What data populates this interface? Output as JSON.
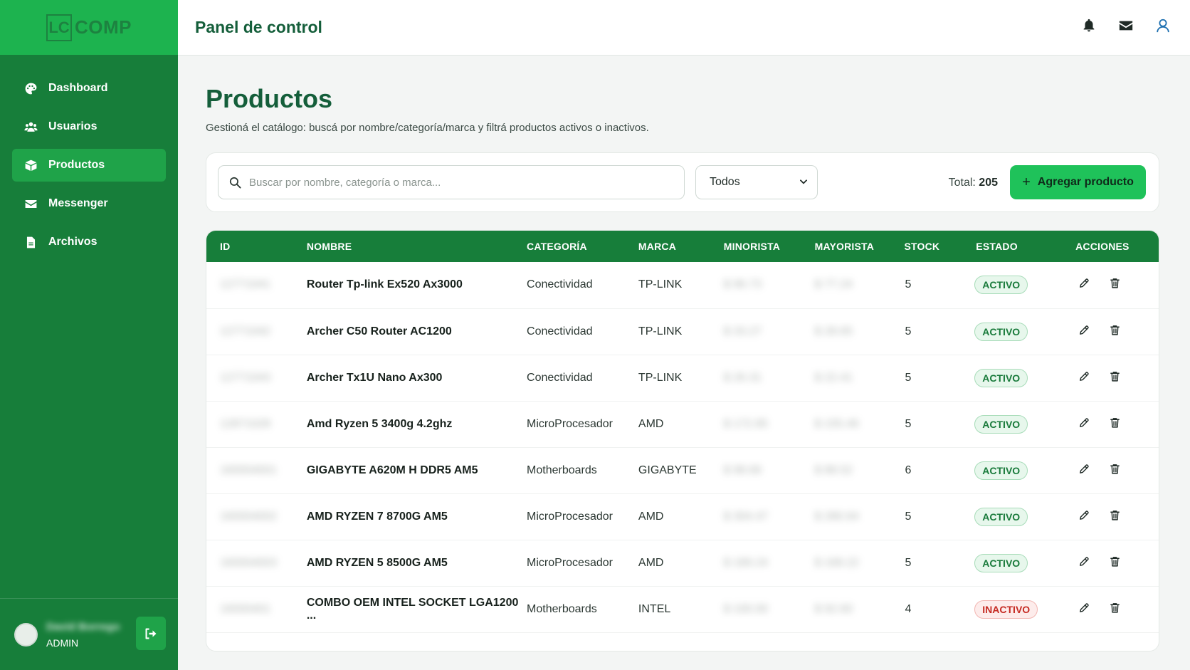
{
  "brand": {
    "logo_mark": "LC",
    "logo_text": "COMP"
  },
  "sidebar": {
    "items": [
      {
        "label": "Dashboard",
        "icon": "palette-icon"
      },
      {
        "label": "Usuarios",
        "icon": "users-icon"
      },
      {
        "label": "Productos",
        "icon": "box-icon",
        "active": true
      },
      {
        "label": "Messenger",
        "icon": "envelope-icon"
      },
      {
        "label": "Archivos",
        "icon": "file-icon"
      }
    ],
    "user": {
      "name": "David Borrego",
      "role": "ADMIN"
    }
  },
  "header": {
    "title": "Panel de control"
  },
  "page": {
    "title": "Productos",
    "subtitle": "Gestioná el catálogo: buscá por nombre/categoría/marca y filtrá productos activos o inactivos."
  },
  "toolbar": {
    "search_placeholder": "Buscar por nombre, categoría o marca...",
    "filter_value": "Todos",
    "total_label": "Total:",
    "total_value": "205",
    "add_label": "Agregar producto"
  },
  "table": {
    "columns": [
      "ID",
      "NOMBRE",
      "CATEGORÍA",
      "MARCA",
      "MINORISTA",
      "MAYORISTA",
      "STOCK",
      "ESTADO",
      "ACCIONES"
    ],
    "rows": [
      {
        "id": "12771041",
        "name": "Router Tp-link Ex520 Ax3000",
        "category": "Conectividad",
        "brand": "TP-LINK",
        "retail": "$ 96.73",
        "wholesale": "$ 77.24",
        "stock": "5",
        "status": "ACTIVO",
        "active": true
      },
      {
        "id": "12771042",
        "name": "Archer C50 Router AC1200",
        "category": "Conectividad",
        "brand": "TP-LINK",
        "retail": "$ 33.27",
        "wholesale": "$ 28.65",
        "stock": "5",
        "status": "ACTIVO",
        "active": true
      },
      {
        "id": "12771043",
        "name": "Archer Tx1U Nano Ax300",
        "category": "Conectividad",
        "brand": "TP-LINK",
        "retail": "$ 26.31",
        "wholesale": "$ 22.41",
        "stock": "5",
        "status": "ACTIVO",
        "active": true
      },
      {
        "id": "12871028",
        "name": "Amd Ryzen 5 3400g 4.2ghz",
        "category": "MicroProcesador",
        "brand": "AMD",
        "retail": "$ 172.85",
        "wholesale": "$ 155.46",
        "stock": "5",
        "status": "ACTIVO",
        "active": true
      },
      {
        "id": "160004001",
        "name": "GIGABYTE A620M H DDR5 AM5",
        "category": "Motherboards",
        "brand": "GIGABYTE",
        "retail": "$ 98.66",
        "wholesale": "$ 88.52",
        "stock": "6",
        "status": "ACTIVO",
        "active": true
      },
      {
        "id": "160004002",
        "name": "AMD RYZEN 7 8700G AM5",
        "category": "MicroProcesador",
        "brand": "AMD",
        "retail": "$ 304.47",
        "wholesale": "$ 280.64",
        "stock": "5",
        "status": "ACTIVO",
        "active": true
      },
      {
        "id": "160004003",
        "name": "AMD RYZEN 5 8500G AM5",
        "category": "MicroProcesador",
        "brand": "AMD",
        "retail": "$ 189.24",
        "wholesale": "$ 168.22",
        "stock": "5",
        "status": "ACTIVO",
        "active": true
      },
      {
        "id": "16000401",
        "name": "COMBO OEM INTEL SOCKET LGA1200 ...",
        "category": "Motherboards",
        "brand": "INTEL",
        "retail": "$ 100.00",
        "wholesale": "$ 92.60",
        "stock": "4",
        "status": "INACTIVO",
        "active": false
      }
    ]
  },
  "colors": {
    "sidebar": "#177e3a",
    "brand_bar": "#1db34f",
    "primary_text": "#145e3a",
    "accent_button": "#1fc25a"
  }
}
